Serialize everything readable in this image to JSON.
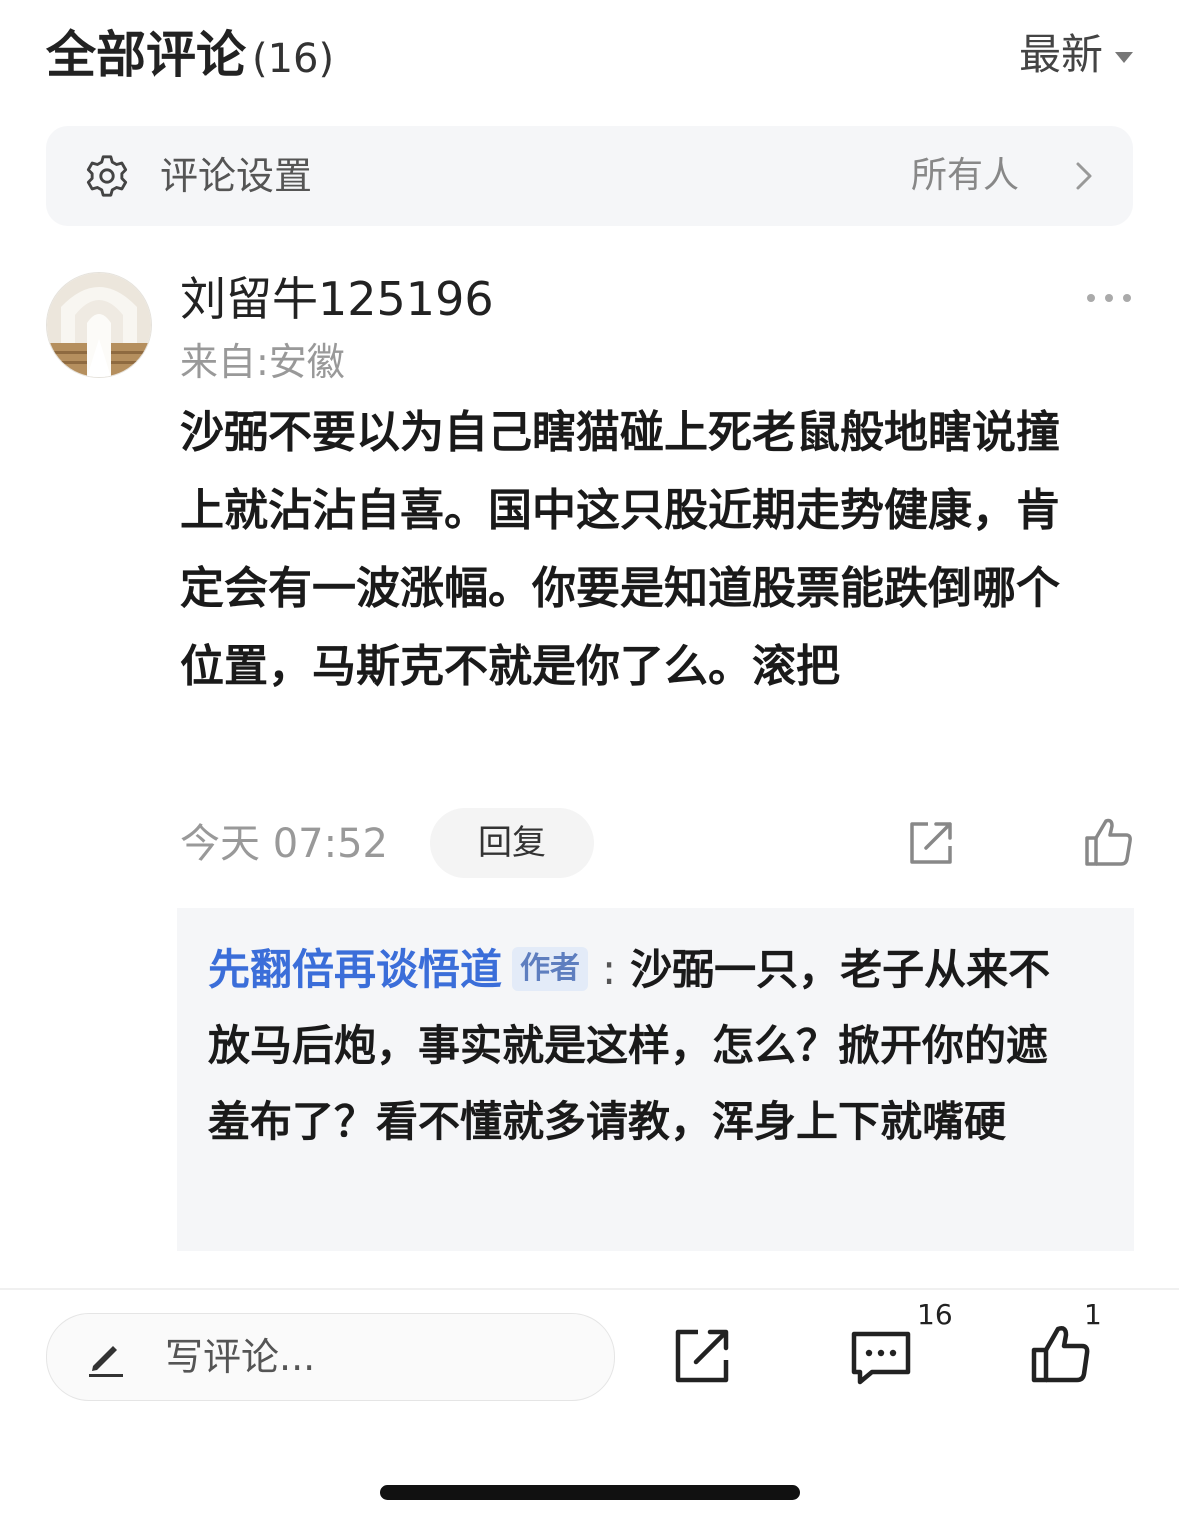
{
  "header": {
    "title": "全部评论",
    "count": "(16)",
    "sort_label": "最新"
  },
  "settings": {
    "label": "评论设置",
    "value": "所有人"
  },
  "comment": {
    "username": "刘留牛125196",
    "location": "来自:安徽",
    "content": "沙弼不要以为自己瞎猫碰上死老鼠般地瞎说撞上就沾沾自喜。国中这只股近期走势健康，肯定会有一波涨幅。你要是知道股票能跌倒哪个位置，马斯克不就是你了么。滚把",
    "time": "今天 07:52",
    "reply_label": "回复"
  },
  "reply": {
    "author": "先翻倍再谈悟道",
    "badge": "作者",
    "colon": ":",
    "text": "沙弼一只，老子从来不放马后炮，事实就是这样，怎么？掀开你的遮羞布了？看不懂就多请教，浑身上下就嘴硬"
  },
  "bottom_bar": {
    "input_placeholder": "写评论...",
    "comment_count": "16",
    "like_count": "1"
  }
}
